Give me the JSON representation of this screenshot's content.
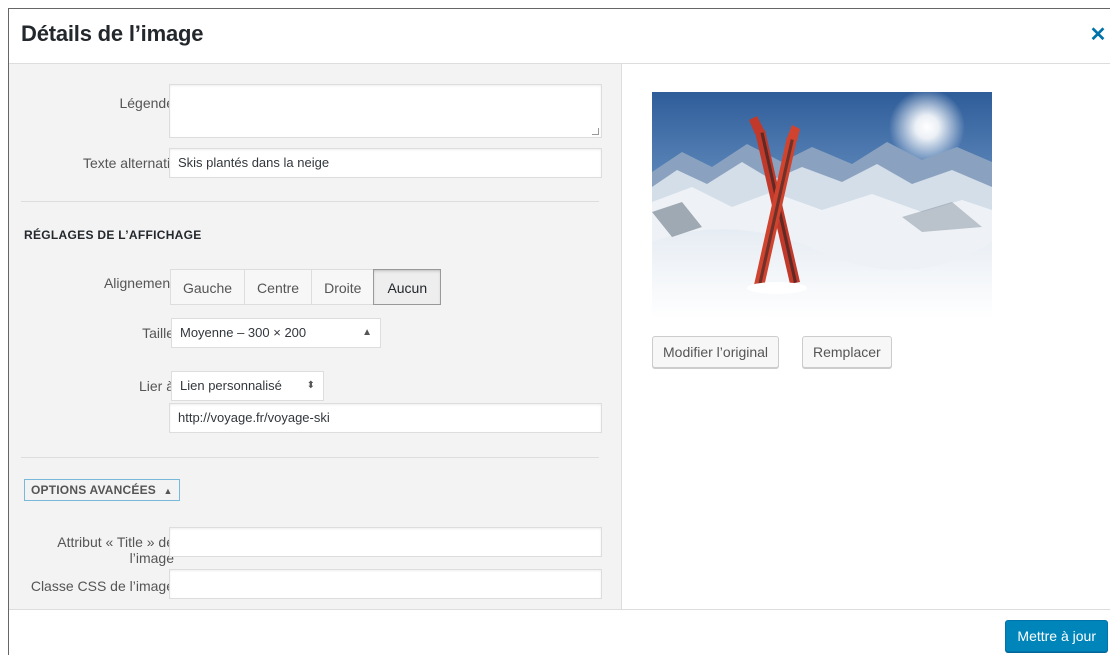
{
  "dialog": {
    "title": "Détails de l’image",
    "close_icon": "close-icon"
  },
  "fields": {
    "caption": {
      "label": "Légende",
      "value": ""
    },
    "alt_text": {
      "label": "Texte alternatif",
      "value": "Skis plantés dans la neige"
    }
  },
  "display_settings": {
    "heading": "RÉGLAGES DE L’AFFICHAGE",
    "alignment": {
      "label": "Alignement",
      "options": [
        "Gauche",
        "Centre",
        "Droite",
        "Aucun"
      ],
      "selected": "Aucun"
    },
    "size": {
      "label": "Taille",
      "value": "Moyenne – 300 × 200"
    },
    "link_to": {
      "label": "Lier à",
      "value": "Lien personnalisé",
      "url": "http://voyage.fr/voyage-ski"
    }
  },
  "advanced": {
    "toggle_label": "OPTIONS AVANCÉES",
    "toggle_icon": "triangle-up-icon",
    "title_attr": {
      "label": "Attribut « Title » de l’image",
      "value": ""
    },
    "css_class": {
      "label": "Classe CSS de l’image",
      "value": ""
    }
  },
  "preview": {
    "edit_label": "Modifier l’original",
    "replace_label": "Remplacer"
  },
  "footer": {
    "update_label": "Mettre à jour"
  },
  "colors": {
    "accent": "#0085ba",
    "close": "#0073aa",
    "sidebar_bg": "#f3f3f3"
  }
}
